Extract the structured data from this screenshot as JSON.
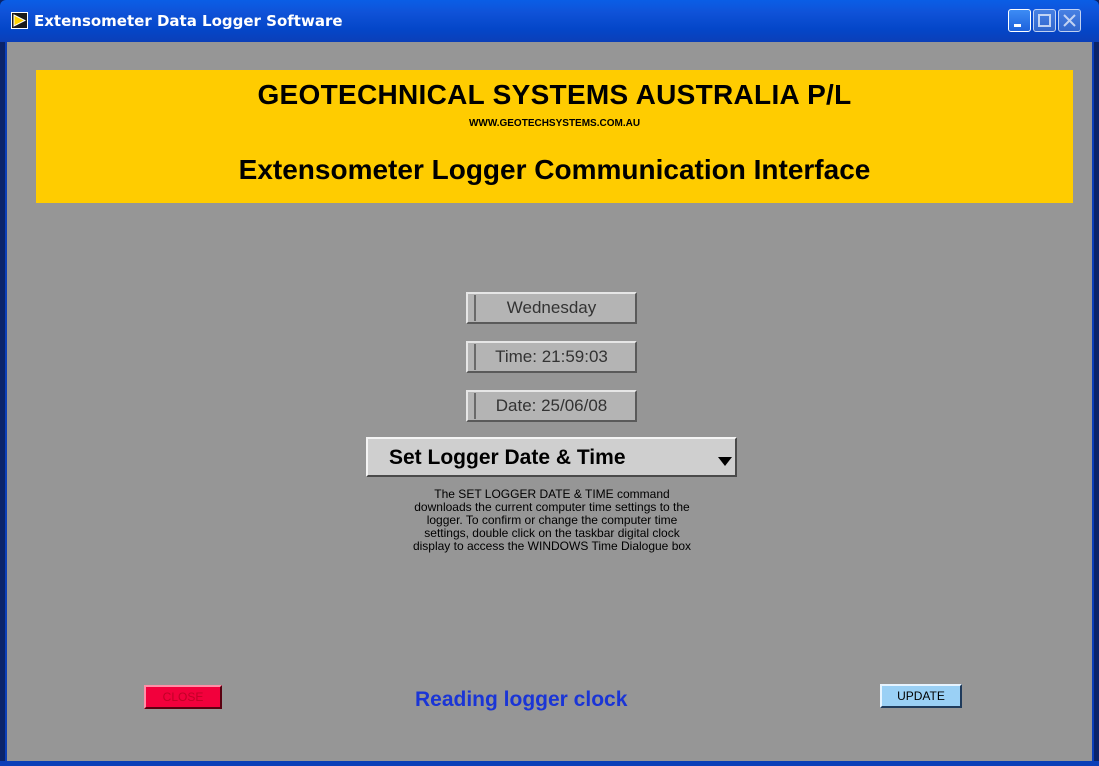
{
  "window": {
    "title": "Extensometer Data Logger Software",
    "icon": "labview-run-arrow-icon"
  },
  "banner": {
    "company": "GEOTECHNICAL SYSTEMS AUSTRALIA P/L",
    "url": "WWW.GEOTECHSYSTEMS.COM.AU",
    "subtitle": "Extensometer Logger Communication Interface",
    "color": "#ffcc00"
  },
  "clock": {
    "day": "Wednesday",
    "time": "Time: 21:59:03",
    "date": "Date: 25/06/08"
  },
  "command": {
    "selected": "Set Logger Date & Time",
    "help_lines": [
      "The SET LOGGER DATE & TIME command",
      "downloads the current computer time settings to the",
      "logger.  To confirm or change the computer time",
      "settings, double click on the taskbar digital clock",
      "display to access the WINDOWS Time Dialogue box"
    ]
  },
  "footer": {
    "close_label": "CLOSE",
    "status": "Reading logger clock",
    "update_label": "UPDATE",
    "close_color": "#f2003c",
    "update_color": "#9ad0f5",
    "status_color": "#1a35d6"
  }
}
